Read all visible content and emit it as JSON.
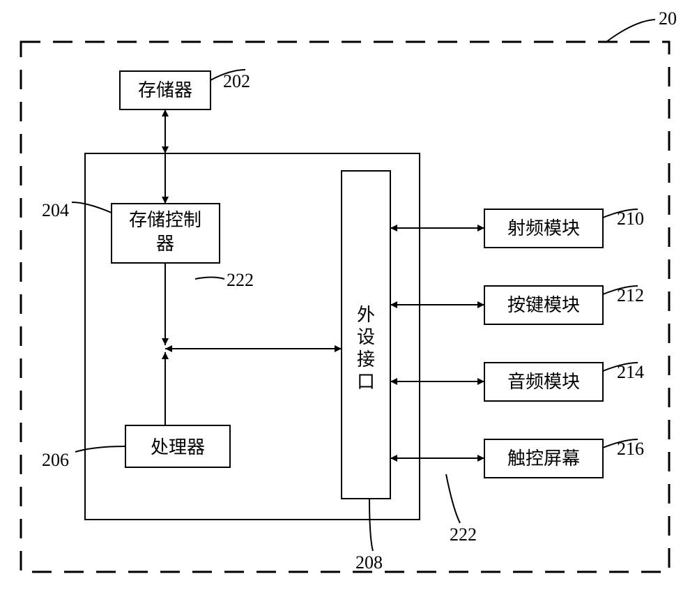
{
  "system_label": "20",
  "blocks": {
    "memory": {
      "label": "存储器",
      "num": "202"
    },
    "mem_ctrl": {
      "label": "存储控制器",
      "num": "204"
    },
    "processor": {
      "label": "处理器",
      "num": "206"
    },
    "periph_if": {
      "label": "外设接口",
      "num": "208"
    },
    "rf": {
      "label": "射频模块",
      "num": "210"
    },
    "keys": {
      "label": "按键模块",
      "num": "212"
    },
    "audio": {
      "label": "音频模块",
      "num": "214"
    },
    "touch": {
      "label": "触控屏幕",
      "num": "216"
    }
  },
  "bus_labels": {
    "upper": "222",
    "lower": "222"
  }
}
